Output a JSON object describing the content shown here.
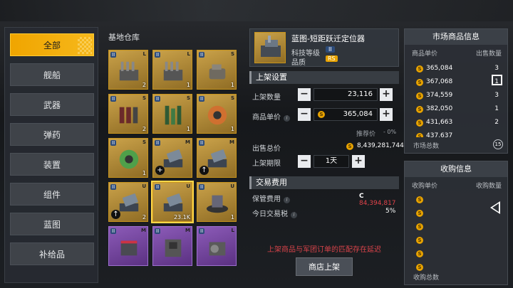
{
  "categories": [
    "全部",
    "舰船",
    "武器",
    "弹药",
    "装置",
    "组件",
    "蓝图",
    "补给品"
  ],
  "warehouse": {
    "title": "基地仓库",
    "items": [
      {
        "tier": "II",
        "size": "L",
        "count": "2",
        "color": "gold",
        "art": "turret"
      },
      {
        "tier": "II",
        "size": "L",
        "count": "1",
        "color": "gold",
        "art": "turret"
      },
      {
        "tier": "II",
        "size": "S",
        "count": "1",
        "color": "gold",
        "art": "hull"
      },
      {
        "tier": "II",
        "size": "S",
        "count": "2",
        "color": "gold",
        "art": "shells"
      },
      {
        "tier": "II",
        "size": "S",
        "count": "1",
        "color": "gold",
        "art": "rods"
      },
      {
        "tier": "II",
        "size": "S",
        "count": "1",
        "color": "gold",
        "art": "coil"
      },
      {
        "tier": "II",
        "size": "S",
        "count": "1",
        "color": "gold",
        "art": "coilg"
      },
      {
        "tier": "II",
        "size": "M",
        "count": "",
        "color": "gold",
        "art": "launcher",
        "plus": "+"
      },
      {
        "tier": "II",
        "size": "M",
        "count": "",
        "color": "gold",
        "art": "launcher",
        "plus": "↑"
      },
      {
        "tier": "II",
        "size": "U",
        "count": "2",
        "color": "gold",
        "art": "launcher",
        "plus": "↑"
      },
      {
        "tier": "II",
        "size": "U",
        "count": "23.1K",
        "color": "gold",
        "art": "launcher",
        "selected": true
      },
      {
        "tier": "II",
        "size": "U",
        "count": "1",
        "color": "gold",
        "art": "platform"
      },
      {
        "tier": "II",
        "size": "M",
        "count": "",
        "color": "purple",
        "art": "box"
      },
      {
        "tier": "II",
        "size": "M",
        "count": "",
        "color": "purple",
        "art": "machine"
      },
      {
        "tier": "II",
        "size": "L",
        "count": "",
        "color": "purple",
        "art": "gearbox"
      }
    ]
  },
  "detail": {
    "name": "蓝图-短距跃迁定位器",
    "tech_label": "科技等级",
    "tech_value": "II",
    "quality_label": "品质",
    "quality_value": "RS",
    "listing_section": "上架设置",
    "qty_label": "上架数量",
    "qty_value": "23,116",
    "price_label": "商品单价",
    "price_value": "365,084",
    "recommend_label": "推荐价",
    "recommend_value": "- 0%",
    "total_label": "出售总价",
    "total_value": "8,439,281,744",
    "deadline_label": "上架期限",
    "deadline_value": "1天",
    "fee_section": "交易费用",
    "storage_fee_label": "保管费用",
    "storage_fee_value": "84,394,817",
    "tax_label": "今日交易税",
    "tax_value": "5%",
    "warning": "上架商品与军团订单的匹配存在延迟",
    "submit_label": "商店上架",
    "minus": "−",
    "plus": "+"
  },
  "market": {
    "title": "市场商品信息",
    "col_price": "商品单价",
    "col_qty": "出售数量",
    "rows": [
      {
        "price": "365,084",
        "qty": "3"
      },
      {
        "price": "367,068",
        "qty": "1"
      },
      {
        "price": "374,559",
        "qty": "3"
      },
      {
        "price": "382,050",
        "qty": "1"
      },
      {
        "price": "431,663",
        "qty": "2"
      },
      {
        "price": "437,637",
        "qty": ""
      }
    ],
    "total_label": "市场总数",
    "total_value": "15"
  },
  "buy": {
    "title": "收购信息",
    "col_price": "收购单价",
    "col_qty": "收购数量",
    "total_label": "收购总数"
  },
  "colors": {
    "accent": "#f0a500",
    "warning": "#d8434a",
    "price_red": "#e0434a"
  }
}
